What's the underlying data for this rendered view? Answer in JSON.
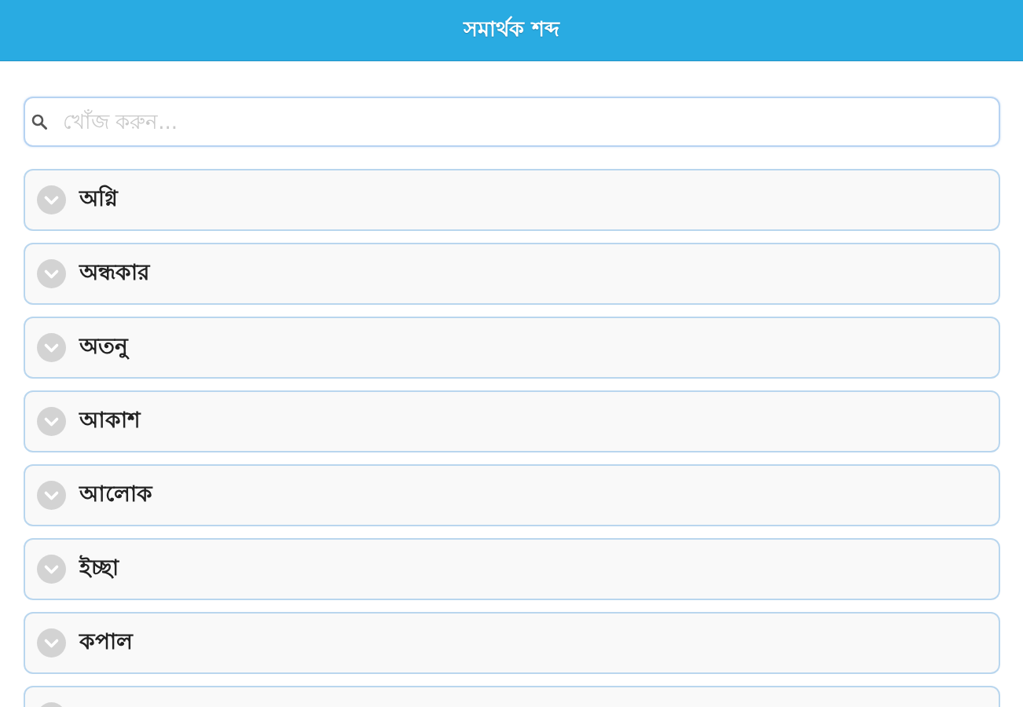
{
  "header": {
    "title": "সমার্থক শব্দ"
  },
  "search": {
    "placeholder": "খোঁজ করুন..."
  },
  "items": [
    {
      "label": "অগ্নি",
      "expanded": false
    },
    {
      "label": "অন্ধকার",
      "expanded": false
    },
    {
      "label": "অতনু",
      "expanded": false
    },
    {
      "label": "আকাশ",
      "expanded": false
    },
    {
      "label": "আলোক",
      "expanded": false
    },
    {
      "label": "ইচ্ছা",
      "expanded": false
    },
    {
      "label": "কপাল",
      "expanded": false
    },
    {
      "expanded": false
    }
  ]
}
